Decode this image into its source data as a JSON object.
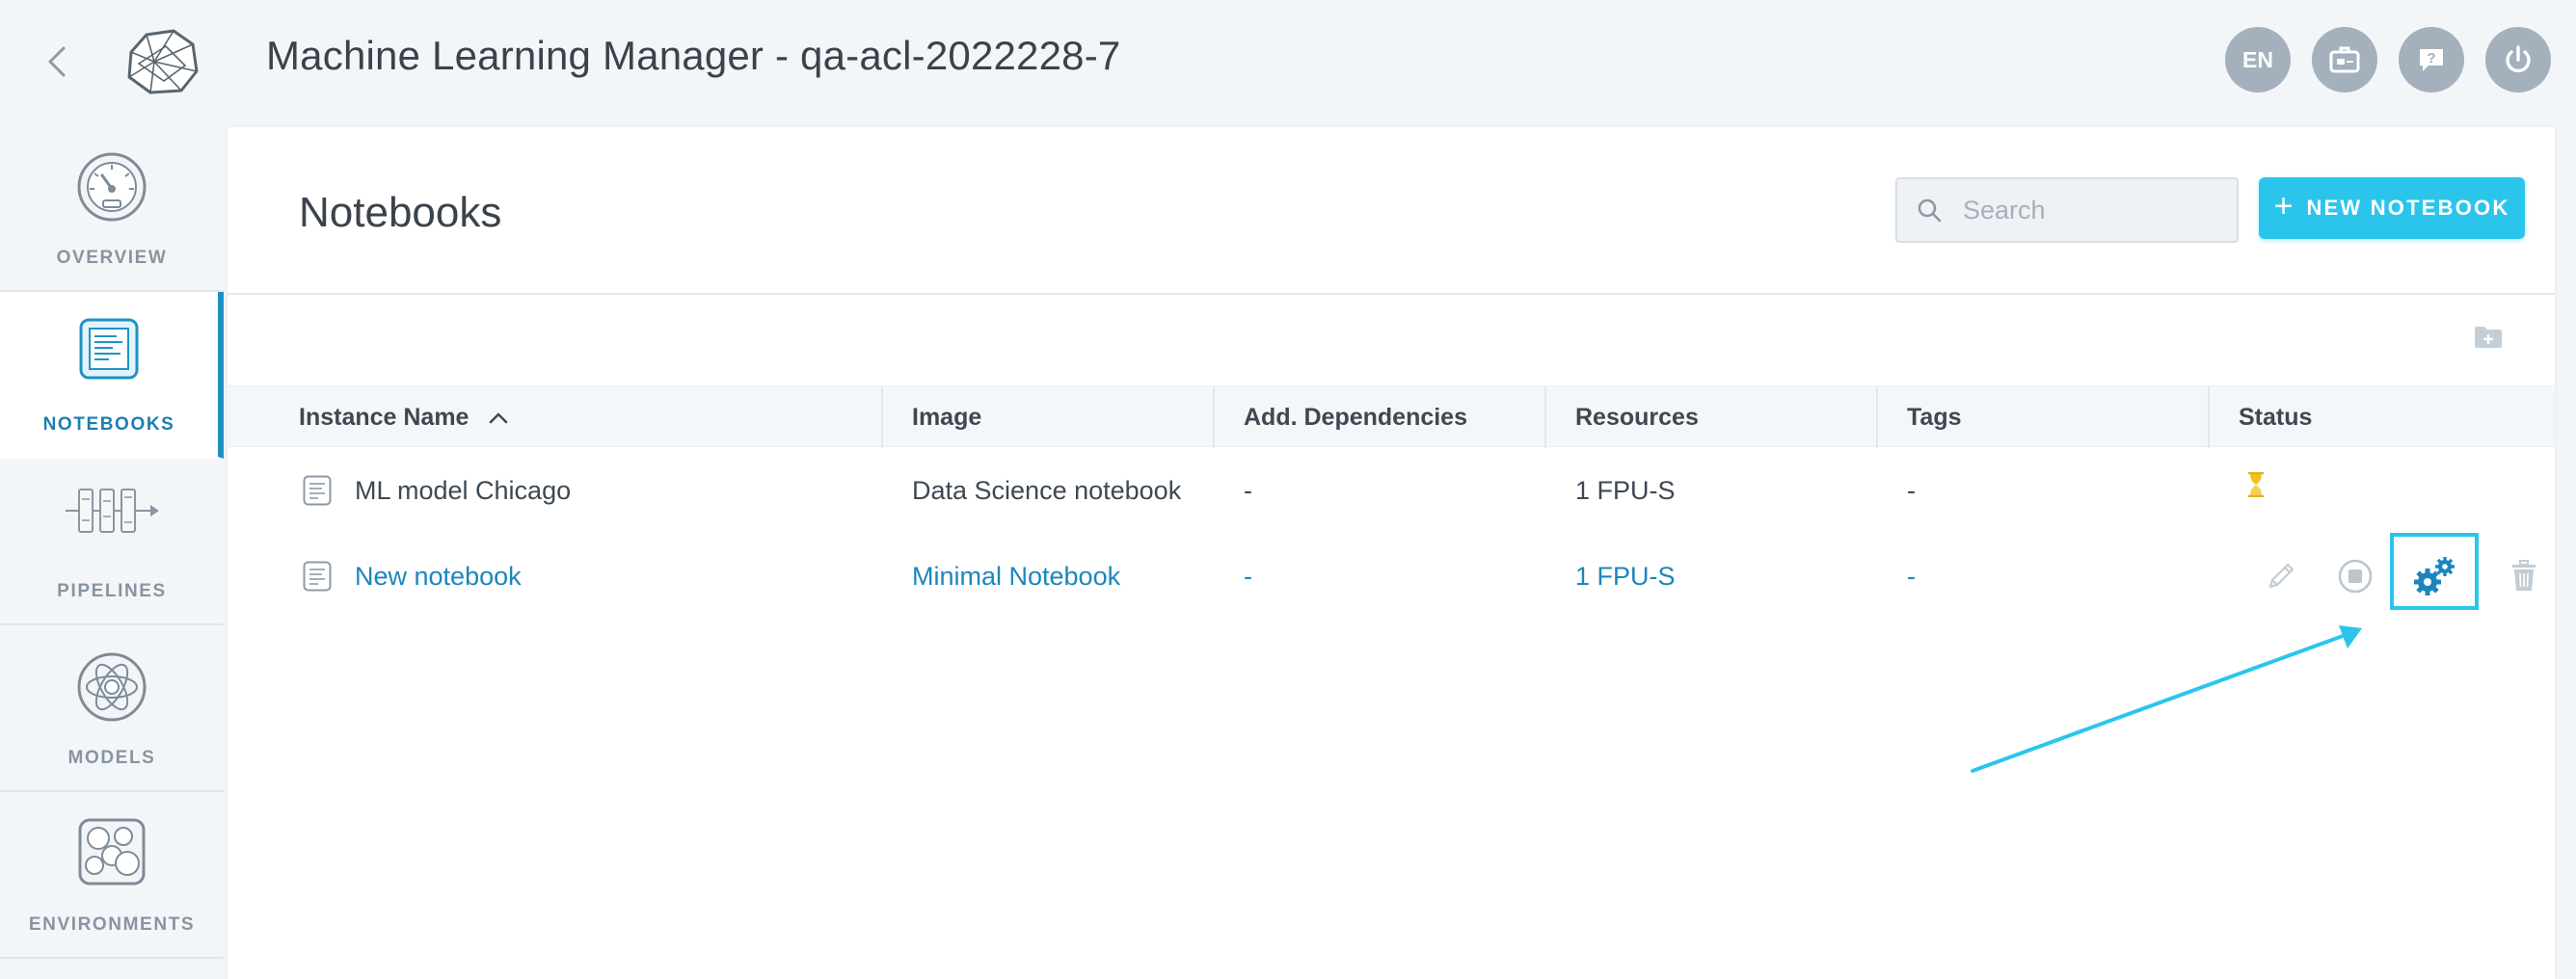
{
  "header": {
    "title": "Machine Learning Manager - qa-acl-2022228-7",
    "language_button": "EN"
  },
  "sidebar": {
    "items": [
      {
        "label": "OVERVIEW",
        "icon": "gauge-icon",
        "active": false
      },
      {
        "label": "NOTEBOOKS",
        "icon": "notebook-icon",
        "active": true
      },
      {
        "label": "PIPELINES",
        "icon": "pipeline-icon",
        "active": false
      },
      {
        "label": "MODELS",
        "icon": "model-icon",
        "active": false
      },
      {
        "label": "ENVIRONMENTS",
        "icon": "environment-icon",
        "active": false
      }
    ]
  },
  "main": {
    "title": "Notebooks",
    "search": {
      "placeholder": "Search",
      "value": ""
    },
    "new_button": {
      "plus": "+",
      "label": "NEW NOTEBOOK"
    },
    "table": {
      "columns": [
        "Instance Name",
        "Image",
        "Add. Dependencies",
        "Resources",
        "Tags",
        "Status"
      ],
      "rows": [
        {
          "name": "ML model Chicago",
          "image": "Data Science notebook",
          "dependencies": "-",
          "resources": "1 FPU-S",
          "tags": "-",
          "status": "pending",
          "highlighted": false
        },
        {
          "name": "New notebook",
          "image": "Minimal Notebook",
          "dependencies": "-",
          "resources": "1 FPU-S",
          "tags": "-",
          "status": "",
          "highlighted": true
        }
      ]
    }
  },
  "colors": {
    "accent": "#2bc5ec",
    "link": "#1b86bd",
    "active_nav": "#1b7fb1",
    "status_pending": "#f2c21b"
  }
}
